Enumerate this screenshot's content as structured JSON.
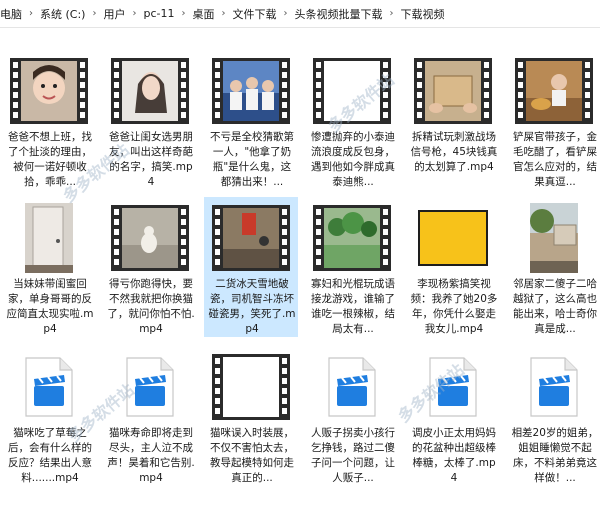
{
  "breadcrumb": [
    "电脑",
    "系统 (C:)",
    "用户",
    "pc-11",
    "桌面",
    "文件下载",
    "头条视频批量下载",
    "下载视频"
  ],
  "files": [
    {
      "type": "video",
      "thumb": "girl-face",
      "caption": "爸爸不想上班，找了个扯淡的理由，被何一诺好顿收拾，乖乖..."
    },
    {
      "type": "video",
      "thumb": "woman-portrait",
      "caption": "爸爸让闺女选男朋友，叫出这样奇葩的名字，搞笑.mp4"
    },
    {
      "type": "video",
      "thumb": "students",
      "caption": "不亏是全校猜歌第一人，\"他拿了奶瓶\"是什么鬼，这都猜出来！..."
    },
    {
      "type": "video",
      "thumb": "blank-white",
      "caption": "惨遭抛弃的小泰迪流浪度成反包身，遇到他如今胖成真泰迪熊..."
    },
    {
      "type": "video",
      "thumb": "box-hands",
      "caption": "拆精试玩刺激战场信号枪，45块钱真的太划算了.mp4"
    },
    {
      "type": "video",
      "thumb": "boy-wood",
      "caption": "铲屎官带孩子，金毛吃醋了，看铲屎官怎么应对的，结果真逗..."
    },
    {
      "type": "video",
      "thumb": "door",
      "caption": "当妹妹带闺蜜回家，单身哥哥的反应简直太现实啦.mp4"
    },
    {
      "type": "video",
      "thumb": "cat-floor",
      "caption": "得亏你跑得快，要不然我就把你换猫了，就问你怕不怕.mp4"
    },
    {
      "type": "video",
      "thumb": "red-sign",
      "caption": "二货冰天雪地破瓷，司机智斗冻坏碰瓷男，笑死了.mp4",
      "selected": true
    },
    {
      "type": "video",
      "thumb": "greens",
      "caption": "寡妇和光棍玩成语接龙游戏，谁输了谁吃一根辣椒，结局太有..."
    },
    {
      "type": "video",
      "thumb": "yellow",
      "caption": "李现杨紫搞笑视频：我养了她20多年，你凭什么娶走我女儿.mp4"
    },
    {
      "type": "video",
      "thumb": "house-tree",
      "caption": "邻居家二傻子二哈越狱了，这么高也能出来，哈士奇你真是成..."
    },
    {
      "type": "media",
      "thumb": "media-icon",
      "caption": "猫咪吃了草莓之后，会有什么样的反应？结果出人意料.......mp4"
    },
    {
      "type": "media",
      "thumb": "media-icon",
      "caption": "猫咪寿命即将走到尽头，主人泣不成声！昊着和它告别.mp4"
    },
    {
      "type": "video",
      "thumb": "blank-white",
      "caption": "猫咪误入时装展，不仅不害怕太去，教导起模特如何走真正的..."
    },
    {
      "type": "media",
      "thumb": "media-icon",
      "caption": "人贩子拐卖小孩行乞挣钱，路过二傻子问一个问题，让人贩子..."
    },
    {
      "type": "media",
      "thumb": "media-icon",
      "caption": "调皮小正太用妈妈的花盆种出超级棒棒糖，太棒了.mp4"
    },
    {
      "type": "media",
      "thumb": "media-icon",
      "caption": "相差20岁的姐弟，姐姐睡懒觉不起床，不料弟弟竟这样做！..."
    }
  ],
  "watermark": "多多软件站",
  "colors": {
    "selected": "#cce8ff",
    "media_blue": "#1f7ee0",
    "film": "#2b2b2b"
  }
}
